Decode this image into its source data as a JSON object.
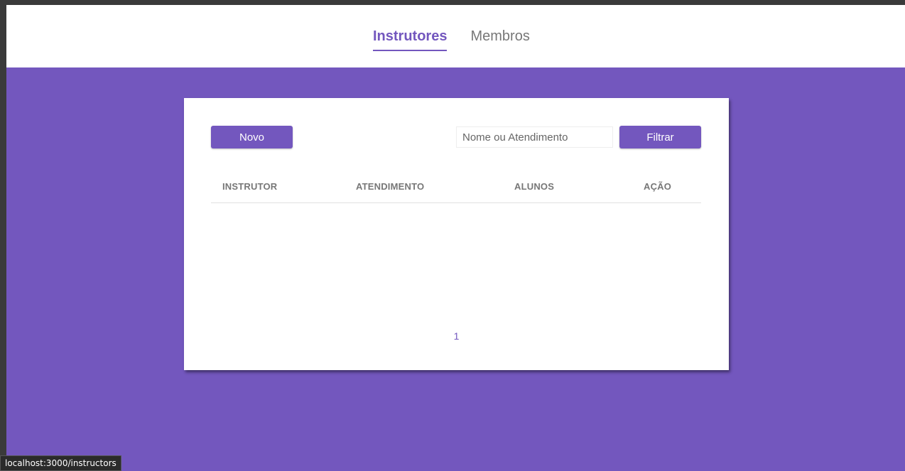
{
  "nav": {
    "items": [
      {
        "label": "Instrutores",
        "active": true
      },
      {
        "label": "Membros",
        "active": false
      }
    ]
  },
  "toolbar": {
    "new_label": "Novo",
    "search_placeholder": "Nome ou Atendimento",
    "search_value": "",
    "filter_label": "Filtrar"
  },
  "table": {
    "columns": [
      "INSTRUTOR",
      "ATENDIMENTO",
      "ALUNOS",
      "AÇÃO"
    ],
    "rows": []
  },
  "pagination": {
    "pages": [
      "1"
    ]
  },
  "status_bar": {
    "url": "localhost:3000/instructors"
  },
  "colors": {
    "accent": "#7357be",
    "background": "#7357be",
    "card": "#ffffff"
  }
}
